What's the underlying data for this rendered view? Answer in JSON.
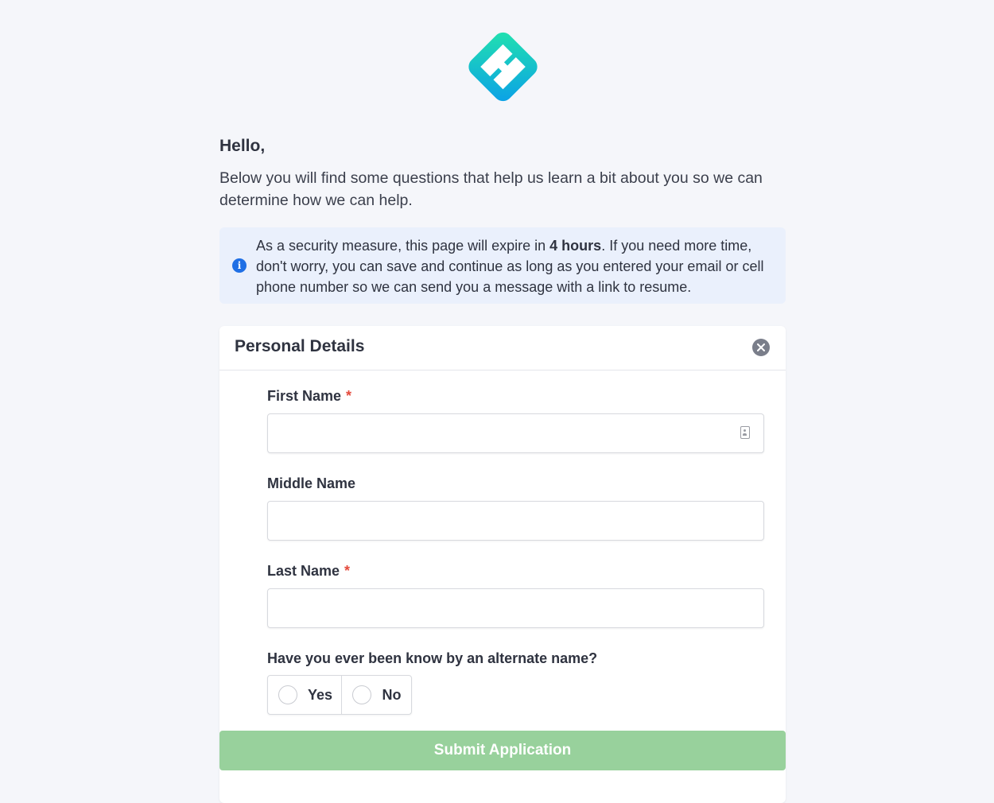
{
  "brand": {
    "logo_icon": "hex-logo-icon",
    "gradient_start": "#1de0b0",
    "gradient_end": "#0aa3e8"
  },
  "intro": {
    "greeting": "Hello,",
    "text": "Below you will find some questions that help us learn a bit about you so we can determine how we can help."
  },
  "notice": {
    "icon": "info-icon",
    "text_before": "As a security measure, this page will expire in ",
    "highlight": "4 hours",
    "text_after": ". If you need more time, don't worry, you can save and continue as long as you entered your email or cell phone number so we can send you a message with a link to resume."
  },
  "section": {
    "title": "Personal Details",
    "close_icon": "close-circle-icon",
    "fields": {
      "first_name": {
        "label": "First Name",
        "required_mark": "*",
        "value": ""
      },
      "middle_name": {
        "label": "Middle Name",
        "value": ""
      },
      "last_name": {
        "label": "Last Name",
        "required_mark": "*",
        "value": ""
      }
    },
    "alternate_name": {
      "question": "Have you ever been know by an alternate name?",
      "options": [
        "Yes",
        "No"
      ]
    }
  },
  "submit": {
    "label": "Submit Application",
    "color": "#98d19c"
  }
}
